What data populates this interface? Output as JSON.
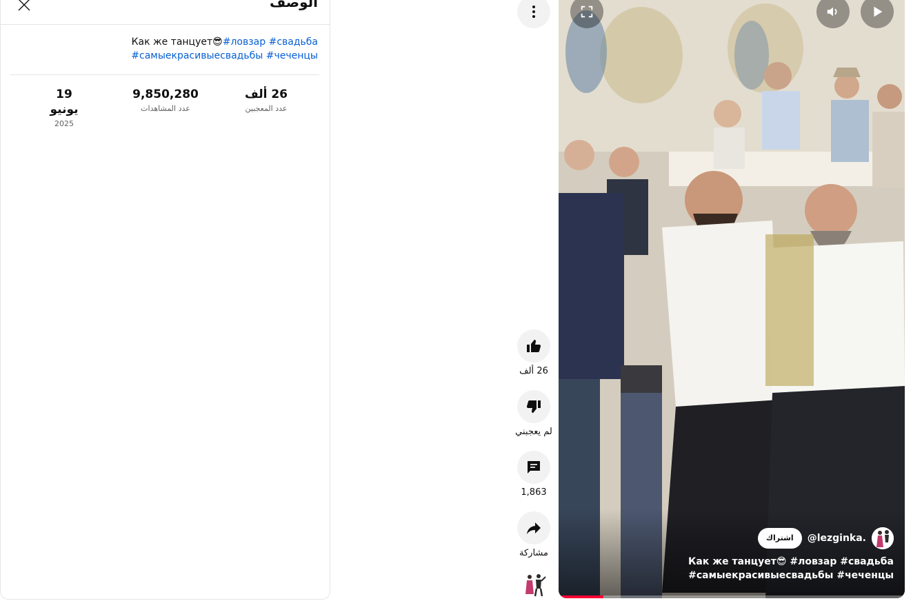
{
  "description_panel": {
    "title": "الوصف",
    "text_plain": "Как же танцует😎",
    "hashtags": [
      "#ловзар",
      "#свадьба",
      "#самыекрасивыесвадьбы",
      "#чеченцы"
    ],
    "stats": {
      "likes_value": "26 ألف",
      "likes_label": "عدد المعجبين",
      "views_value": "9,850,280",
      "views_label": "عدد المشاهدات",
      "date_value": "19 يونيو",
      "date_label": "2025"
    }
  },
  "actions": {
    "like_label": "26 ألف",
    "dislike_label": "لم يعجبني",
    "comments_label": "1,863",
    "share_label": "مشاركة"
  },
  "video": {
    "channel_handle": "@lezginka.",
    "subscribe_label": "اشتراك",
    "caption": "Как же танцует😎 #ловзар #свадьба #самыекрасивыесвадьбы #чеченцы",
    "progress": 0.13
  },
  "colors": {
    "link": "#065fd4",
    "progress": "#ff0033"
  },
  "icons": [
    "close-icon",
    "more-vert-icon",
    "fullscreen-icon",
    "volume-icon",
    "play-icon",
    "thumb-up-icon",
    "thumb-down-icon",
    "comment-icon",
    "share-icon"
  ]
}
